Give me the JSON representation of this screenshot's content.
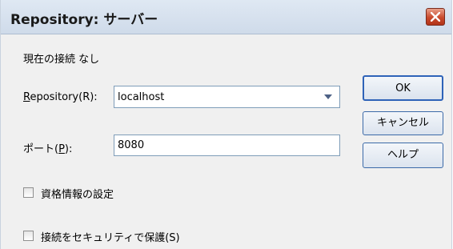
{
  "window": {
    "title": "Repository: サーバー"
  },
  "status_text": "現在の接続 なし",
  "repository": {
    "label": "Repository(",
    "label_mnemonic": "R",
    "label_suffix": "):",
    "label_first_char": "R",
    "value": "localhost"
  },
  "port": {
    "label": "ポート(",
    "label_mnemonic": "P",
    "label_suffix": "):",
    "value": "8080"
  },
  "buttons": {
    "ok": "OK",
    "cancel": "キャンセル",
    "help": "ヘルプ"
  },
  "checkboxes": [
    {
      "label": "資格情報の設定",
      "checked": false
    },
    {
      "label": "接続をセキュリティで保護(S)",
      "checked": false
    }
  ],
  "colors": {
    "close_button": "#c9492c",
    "button_border": "#3c6aa8"
  },
  "icons": {
    "close": "close-icon",
    "dropdown": "chevron-down-icon"
  }
}
